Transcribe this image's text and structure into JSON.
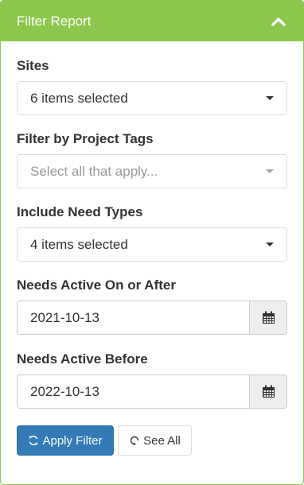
{
  "panel": {
    "title": "Filter Report",
    "collapse_icon": "chevron-up-icon",
    "accent": "#8cc84b"
  },
  "filters": {
    "sites": {
      "label": "Sites",
      "value": "6 items selected"
    },
    "project_tags": {
      "label": "Filter by Project Tags",
      "placeholder": "Select all that apply..."
    },
    "need_types": {
      "label": "Include Need Types",
      "value": "4 items selected"
    },
    "active_after": {
      "label": "Needs Active On or After",
      "value": "2021-10-13",
      "icon": "calendar-icon"
    },
    "active_before": {
      "label": "Needs Active Before",
      "value": "2022-10-13",
      "icon": "calendar-icon"
    }
  },
  "actions": {
    "apply": {
      "label": "Apply Filter",
      "icon": "refresh-icon",
      "color": "#337ab7"
    },
    "see_all": {
      "label": "See All",
      "icon": "refresh-icon"
    }
  }
}
